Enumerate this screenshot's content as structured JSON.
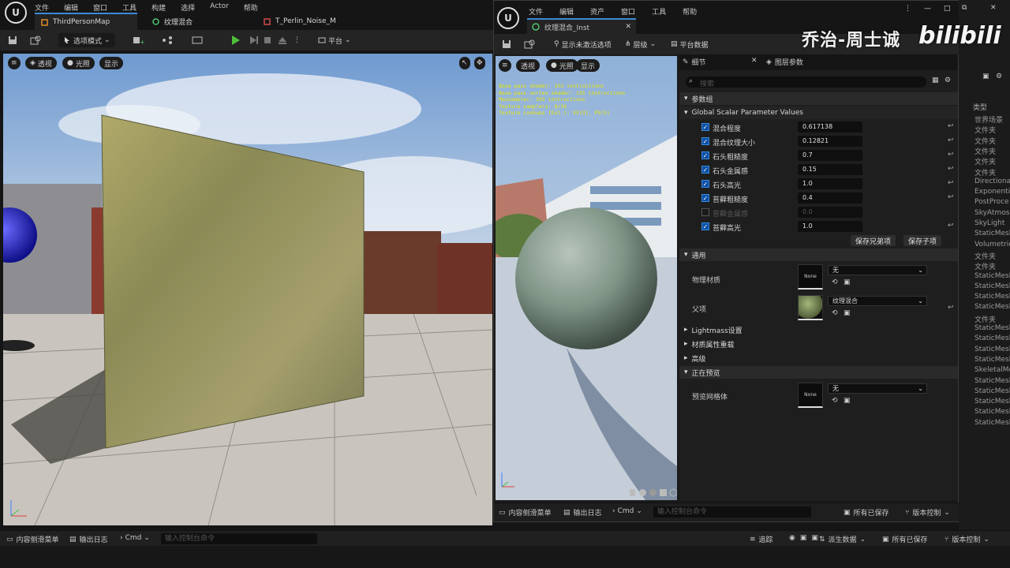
{
  "menubar": {
    "items": [
      "文件",
      "编辑",
      "窗口",
      "工具",
      "构建",
      "选择",
      "Actor",
      "帮助"
    ]
  },
  "tabs": [
    {
      "label": "ThirdPersonMap"
    },
    {
      "label": "纹理混合"
    },
    {
      "label": "T_Perlin_Noise_M"
    }
  ],
  "toolbar": {
    "mode_label": "选项模式",
    "platform_label": "平台"
  },
  "viewport": {
    "perspective": "透视",
    "lit": "光照",
    "show": "显示"
  },
  "statusbar": {
    "content_drawer": "内容侧滑菜单",
    "output_log": "输出日志",
    "cmd": "Cmd",
    "cmd_placeholder": "输入控制台命令",
    "trace": "追踪",
    "derived_data": "派生数据",
    "save_all": "所有已保存",
    "revision_control": "版本控制"
  },
  "mi": {
    "window_menu": [
      "文件",
      "编辑",
      "资产",
      "窗口",
      "工具",
      "帮助"
    ],
    "tab_title": "纹理混合_Inst",
    "toolbar": {
      "show_inactive": "显示未激活选项",
      "hierarchy": "层级",
      "platform_stats": "平台数据"
    },
    "viewport": {
      "perspective": "透视",
      "lit": "光照",
      "show": "显示"
    },
    "stats": "Base pass shader: 253 instructions\nBase pass vertex shader: 135 instructions\nMaxSampler: 303 instructions\nTexture samplers: 8/16\nTexture Lookups (Est.): VS(3), PS(5)",
    "details_tabs": [
      "细节",
      "图层参数"
    ],
    "search_placeholder": "搜索",
    "group_label": "参数组",
    "scalar_group": "Global Scalar Parameter Values",
    "params": [
      {
        "name": "混合程度",
        "value": "0.617138",
        "enabled": true
      },
      {
        "name": "混合纹理大小",
        "value": "0.12821",
        "enabled": true
      },
      {
        "name": "石头粗糙度",
        "value": "0.7",
        "enabled": true
      },
      {
        "name": "石头金属感",
        "value": "0.15",
        "enabled": true
      },
      {
        "name": "石头高光",
        "value": "1.0",
        "enabled": true
      },
      {
        "name": "苔藓粗糙度",
        "value": "0.4",
        "enabled": true
      },
      {
        "name": "苔藓金属感",
        "value": "0.0",
        "enabled": false
      },
      {
        "name": "苔藓高光",
        "value": "1.0",
        "enabled": true
      }
    ],
    "save_sibling": "保存兄弟项",
    "save_child": "保存子项",
    "general": "通用",
    "phys_material": "物理材质",
    "phys_value": "无",
    "none_label": "None",
    "parent": "父项",
    "parent_value": "纹理混合",
    "lightmass": "Lightmass设置",
    "material_override": "材质属性重载",
    "advanced": "高级",
    "previewing": "正在预览",
    "preview_mesh": "预览网格体",
    "preview_value": "无",
    "status": {
      "content_drawer": "内容侧滑菜单",
      "output_log": "输出日志",
      "cmd": "Cmd",
      "cmd_placeholder": "输入控制台命令",
      "save_all": "所有已保存",
      "revision_control": "版本控制"
    }
  },
  "outliner": {
    "header": "类型",
    "items": [
      "世界场景",
      "文件夹",
      "文件夹",
      "文件夹",
      "文件夹",
      "文件夹",
      "Directional",
      "Exponentia",
      "PostProce",
      "SkyAtmosp",
      "SkyLight",
      "StaticMesh",
      "Volumetric",
      "文件夹",
      "文件夹",
      "StaticMesh",
      "StaticMesh",
      "StaticMesh",
      "StaticMesh",
      "文件夹",
      "StaticMesh",
      "StaticMesh",
      "StaticMesh",
      "StaticMesh",
      "SkeletalMe",
      "StaticMesh",
      "StaticMesh",
      "StaticMesh",
      "StaticMesh",
      "StaticMesh"
    ]
  },
  "watermark": {
    "author": "乔治-周士诚",
    "site": "bilibili"
  }
}
